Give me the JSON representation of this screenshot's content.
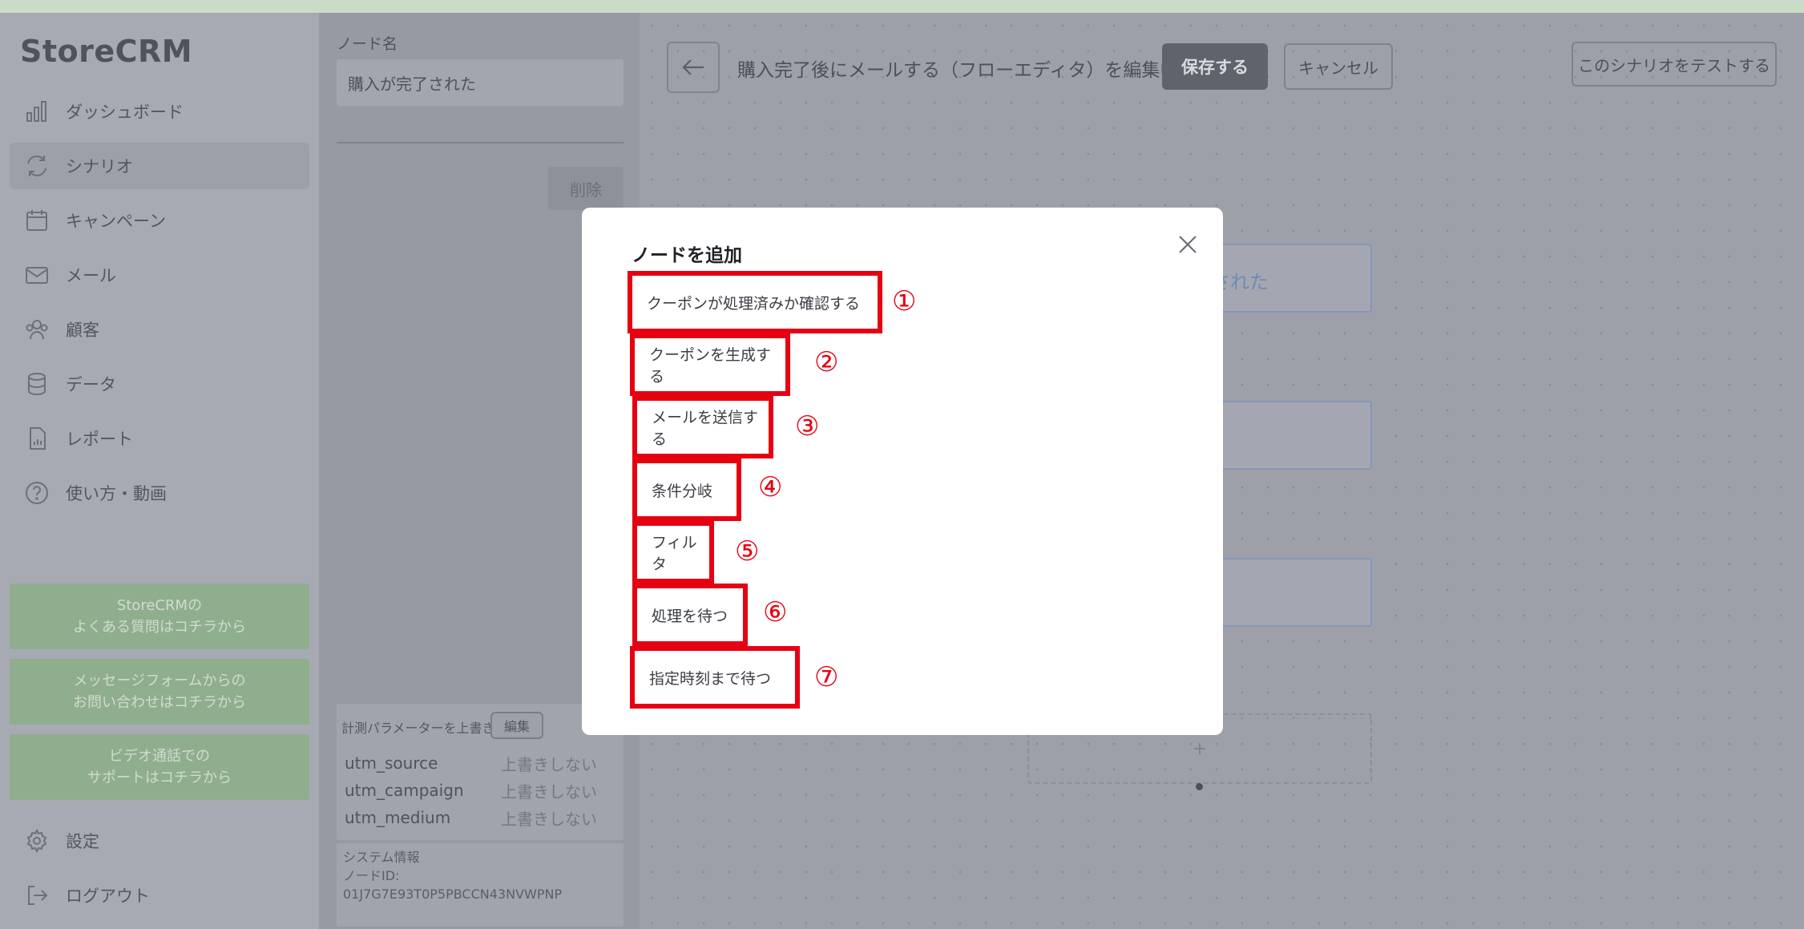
{
  "app": {
    "logo": "StoreCRM"
  },
  "sidebar": {
    "items": [
      {
        "label": "ダッシュボード",
        "icon": "bar-chart-icon"
      },
      {
        "label": "シナリオ",
        "icon": "refresh-icon",
        "active": true
      },
      {
        "label": "キャンペーン",
        "icon": "calendar-icon"
      },
      {
        "label": "メール",
        "icon": "mail-icon"
      },
      {
        "label": "顧客",
        "icon": "users-icon"
      },
      {
        "label": "データ",
        "icon": "database-icon"
      },
      {
        "label": "レポート",
        "icon": "report-icon"
      },
      {
        "label": "使い方・動画",
        "icon": "help-circle-icon"
      }
    ],
    "help_buttons": [
      {
        "line1": "StoreCRMの",
        "line2": "よくある質問はコチラから"
      },
      {
        "line1": "メッセージフォームからの",
        "line2": "お問い合わせはコチラから"
      },
      {
        "line1": "ビデオ通話での",
        "line2": "サポートはコチラから"
      }
    ],
    "settings_label": "設定",
    "logout_label": "ログアウト"
  },
  "node_panel": {
    "name_label": "ノード名",
    "name_value": "購入が完了された",
    "delete_label": "削除",
    "params_title": "計測パラメーターを上書き",
    "params_edit": "編集",
    "params": [
      {
        "key": "utm_source",
        "value": "上書きしない"
      },
      {
        "key": "utm_campaign",
        "value": "上書きしない"
      },
      {
        "key": "utm_medium",
        "value": "上書きしない"
      }
    ],
    "system_info_title": "システム情報",
    "node_id_label": "ノードID:",
    "node_id_value": "01J7G7E93T0P5PBCCN43NVWPNP"
  },
  "editor": {
    "title": "購入完了後にメールする（フローエディタ）を編集中",
    "save_label": "保存する",
    "cancel_label": "キャンセル",
    "test_label": "このシナリオをテストする",
    "node_partial_text": "された",
    "add_symbol": "+"
  },
  "modal": {
    "title": "ノードを追加",
    "options": [
      {
        "label": "クーポンが処理済みか確認する",
        "marker": "①"
      },
      {
        "label": "クーポンを生成する",
        "marker": "②"
      },
      {
        "label": "メールを送信する",
        "marker": "③"
      },
      {
        "label": "条件分岐",
        "marker": "④"
      },
      {
        "label": "フィルタ",
        "marker": "⑤"
      },
      {
        "label": "処理を待つ",
        "marker": "⑥"
      },
      {
        "label": "指定時刻まで待つ",
        "marker": "⑦"
      }
    ],
    "highlight_color": "#e60012"
  }
}
